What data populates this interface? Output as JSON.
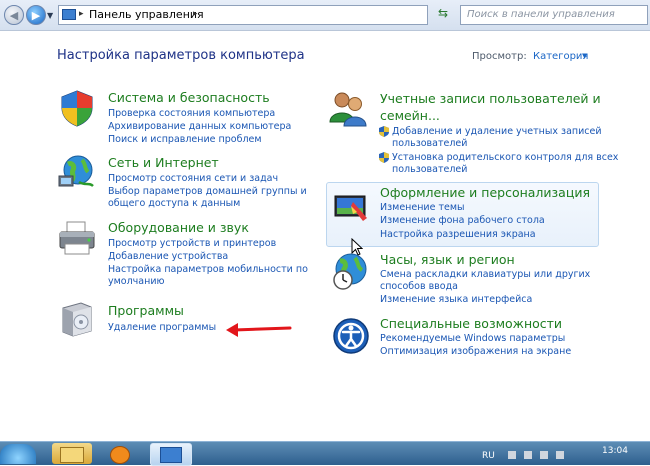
{
  "address": {
    "breadcrumb": "Панель управления",
    "search_placeholder": "Поиск в панели управления"
  },
  "header": {
    "title": "Настройка параметров компьютера",
    "view_label": "Просмотр:",
    "view_value": "Категория"
  },
  "categories": {
    "system": {
      "title": "Система и безопасность",
      "links": [
        "Проверка состояния компьютера",
        "Архивирование данных компьютера",
        "Поиск и исправление проблем"
      ]
    },
    "network": {
      "title": "Сеть и Интернет",
      "links": [
        "Просмотр состояния сети и задач",
        "Выбор параметров домашней группы и",
        "общего доступа к данным"
      ]
    },
    "hardware": {
      "title": "Оборудование и звук",
      "links": [
        "Просмотр устройств и принтеров",
        "Добавление устройства",
        "Настройка параметров мобильности по",
        "умолчанию"
      ]
    },
    "programs": {
      "title": "Программы",
      "links": [
        "Удаление программы"
      ]
    },
    "users": {
      "title_line1": "Учетные записи пользователей и",
      "title_line2": "семейн...",
      "links": [
        "Добавление и удаление учетных записей",
        "пользователей",
        "Установка родительского контроля для всех",
        "пользователей"
      ]
    },
    "appearance": {
      "title": "Оформление и персонализация",
      "links": [
        "Изменение темы",
        "Изменение фона рабочего стола",
        "Настройка разрешения экрана"
      ]
    },
    "clock": {
      "title": "Часы, язык и регион",
      "links": [
        "Смена раскладки клавиатуры или других",
        "способов ввода",
        "Изменение языка интерфейса"
      ]
    },
    "access": {
      "title": "Специальные возможности",
      "links": [
        "Рекомендуемые Windows параметры",
        "Оптимизация изображения на экране"
      ]
    }
  },
  "taskbar": {
    "lang": "RU",
    "time": "13:04"
  },
  "colors": {
    "link": "#1a56b3",
    "category_title": "#1d7d1f",
    "page_title": "#1e3287",
    "arrow": "#e2161b"
  }
}
